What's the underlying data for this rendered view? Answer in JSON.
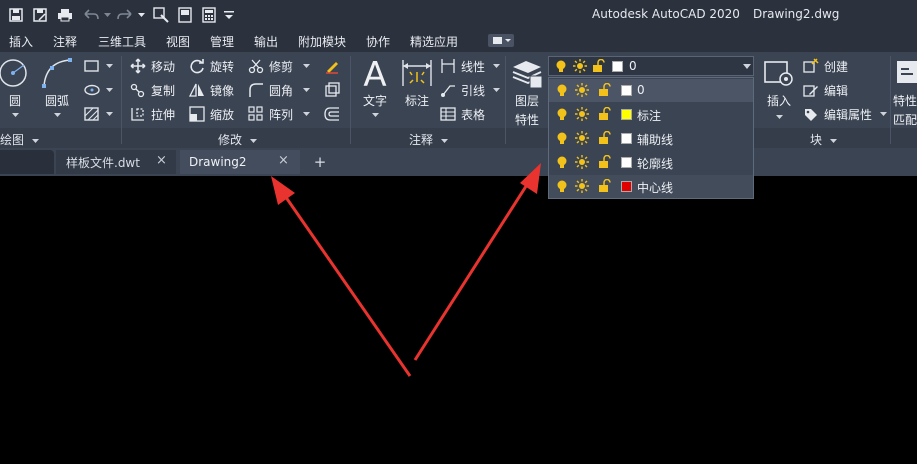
{
  "app": {
    "title": "Autodesk AutoCAD 2020",
    "document": "Drawing2.dwg"
  },
  "menu": [
    "插入",
    "注释",
    "三维工具",
    "视图",
    "管理",
    "输出",
    "附加模块",
    "协作",
    "精选应用"
  ],
  "ribbon": {
    "draw": {
      "circle": "圆",
      "arc": "圆弧",
      "title": "绘图"
    },
    "modify": {
      "move": "移动",
      "rotate": "旋转",
      "trim": "修剪",
      "copy": "复制",
      "mirror": "镜像",
      "fillet": "圆角",
      "stretch": "拉伸",
      "scale": "缩放",
      "array": "阵列",
      "title": "修改"
    },
    "annotation": {
      "text": "文字",
      "dimension": "标注",
      "linear": "线性",
      "leader": "引线",
      "table": "表格",
      "title": "注释"
    },
    "layers": {
      "properties_line1": "图层",
      "properties_line2": "特性",
      "current_layer": "0"
    },
    "block": {
      "insert": "插入",
      "create": "创建",
      "edit": "编辑",
      "edit_attributes": "编辑属性",
      "title": "块"
    },
    "properties": {
      "label_line1": "特性",
      "label_line2": "匹配"
    }
  },
  "tabs": {
    "template": "样板文件.dwt",
    "drawing": "Drawing2",
    "close": "×",
    "new": "+"
  },
  "layer_dropdown": {
    "layers": [
      {
        "name": "0",
        "color": "#ffffff"
      },
      {
        "name": "标注",
        "color": "#ffff00"
      },
      {
        "name": "辅助线",
        "color": "#ffffff"
      },
      {
        "name": "轮廓线",
        "color": "#ffffff"
      },
      {
        "name": "中心线",
        "color": "#e00000"
      }
    ]
  },
  "colors": {
    "titlebar": "#2b313d",
    "ribbon": "#3b4453",
    "canvas": "#000000",
    "arrow": "#e8332f",
    "bulb": "#f2c21b",
    "sun": "#f2c21b",
    "lock": "#f2c21b"
  }
}
